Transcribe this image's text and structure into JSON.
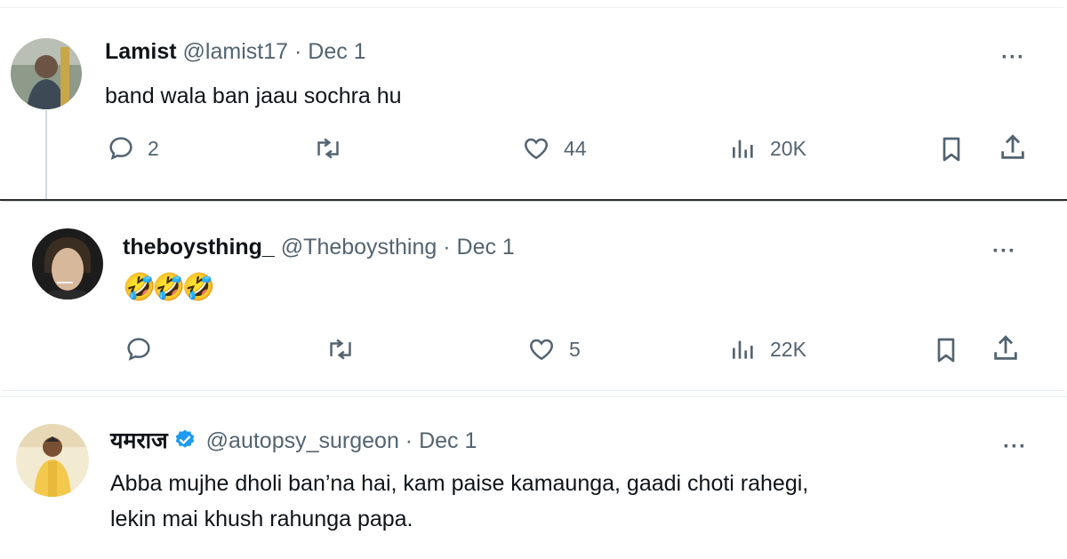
{
  "tweets": [
    {
      "name": "Lamist",
      "handle": "@lamist17",
      "date": "Dec 1",
      "text": "band wala ban jaau sochra hu",
      "replies": "2",
      "likes": "44",
      "views": "20K"
    },
    {
      "name": "theboysthing_",
      "handle": "@Theboysthing",
      "date": "Dec 1",
      "text": "🤣🤣🤣",
      "replies": "",
      "likes": "5",
      "views": "22K"
    },
    {
      "name": "यमराज",
      "handle": "@autopsy_surgeon",
      "date": "Dec 1",
      "text_line1": "Abba mujhe dholi ban’na hai, kam paise kamaunga, gaadi choti rahegi,",
      "text_line2": "lekin mai khush rahunga papa."
    }
  ],
  "separator": "·",
  "more_label": "···",
  "icons": [
    "reply-icon",
    "retweet-icon",
    "like-icon",
    "views-icon",
    "bookmark-icon",
    "share-icon",
    "verified-badge-icon"
  ],
  "colors": {
    "text": "#0f1419",
    "secondary": "#536471",
    "verified": "#1d9bf0"
  }
}
